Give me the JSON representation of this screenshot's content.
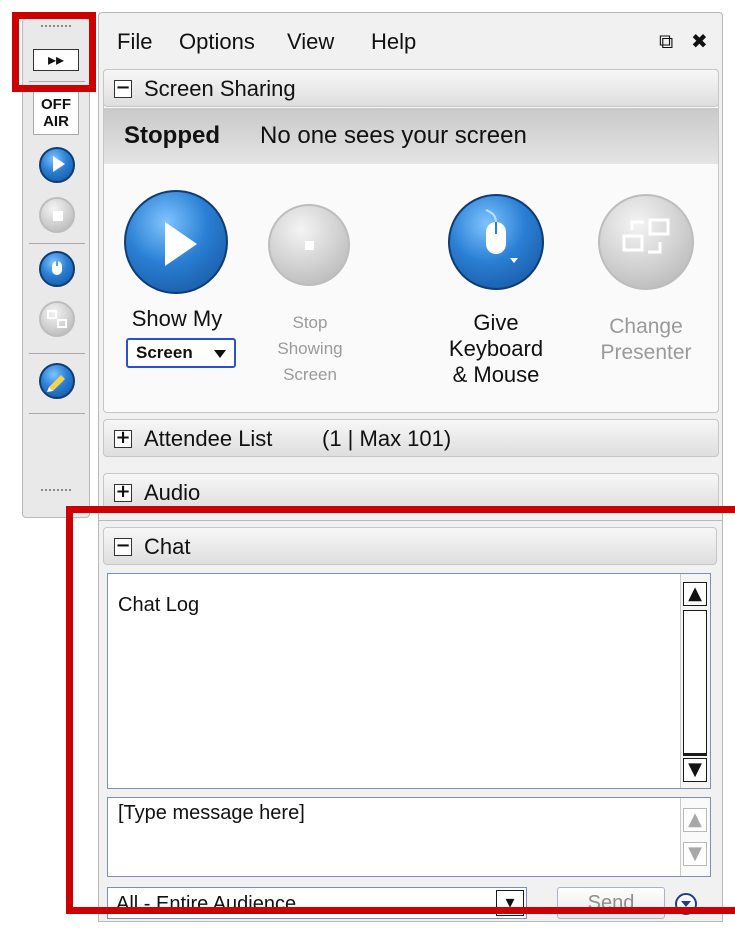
{
  "toolbar": {
    "expand_label": "▸▸",
    "offair_label": "OFF\nAIR",
    "icons": [
      "play-icon",
      "stop-icon",
      "mouse-icon",
      "change-presenter-icon",
      "annotate-icon"
    ]
  },
  "menu": {
    "file": "File",
    "options": "Options",
    "view": "View",
    "help": "Help",
    "popout": "⧉",
    "close": "✖"
  },
  "screen_sharing": {
    "title": "Screen Sharing",
    "status_label": "Stopped",
    "status_text": "No one sees your screen",
    "show_my": "Show My",
    "screen_select": "Screen",
    "stop_showing": "Stop\nShowing\nScreen",
    "give_keyboard": "Give\nKeyboard\n& Mouse",
    "change_presenter": "Change\nPresenter"
  },
  "attendee_list": {
    "title": "Attendee List",
    "count": "(1 | Max 101)"
  },
  "audio": {
    "title": "Audio"
  },
  "chat": {
    "title": "Chat",
    "log_label": "Chat Log",
    "message_placeholder": "[Type message here]",
    "audience": "All - Entire Audience",
    "send": "Send"
  },
  "colors": {
    "highlight": "#cc0000",
    "blue_button": "#2a7fd4"
  }
}
